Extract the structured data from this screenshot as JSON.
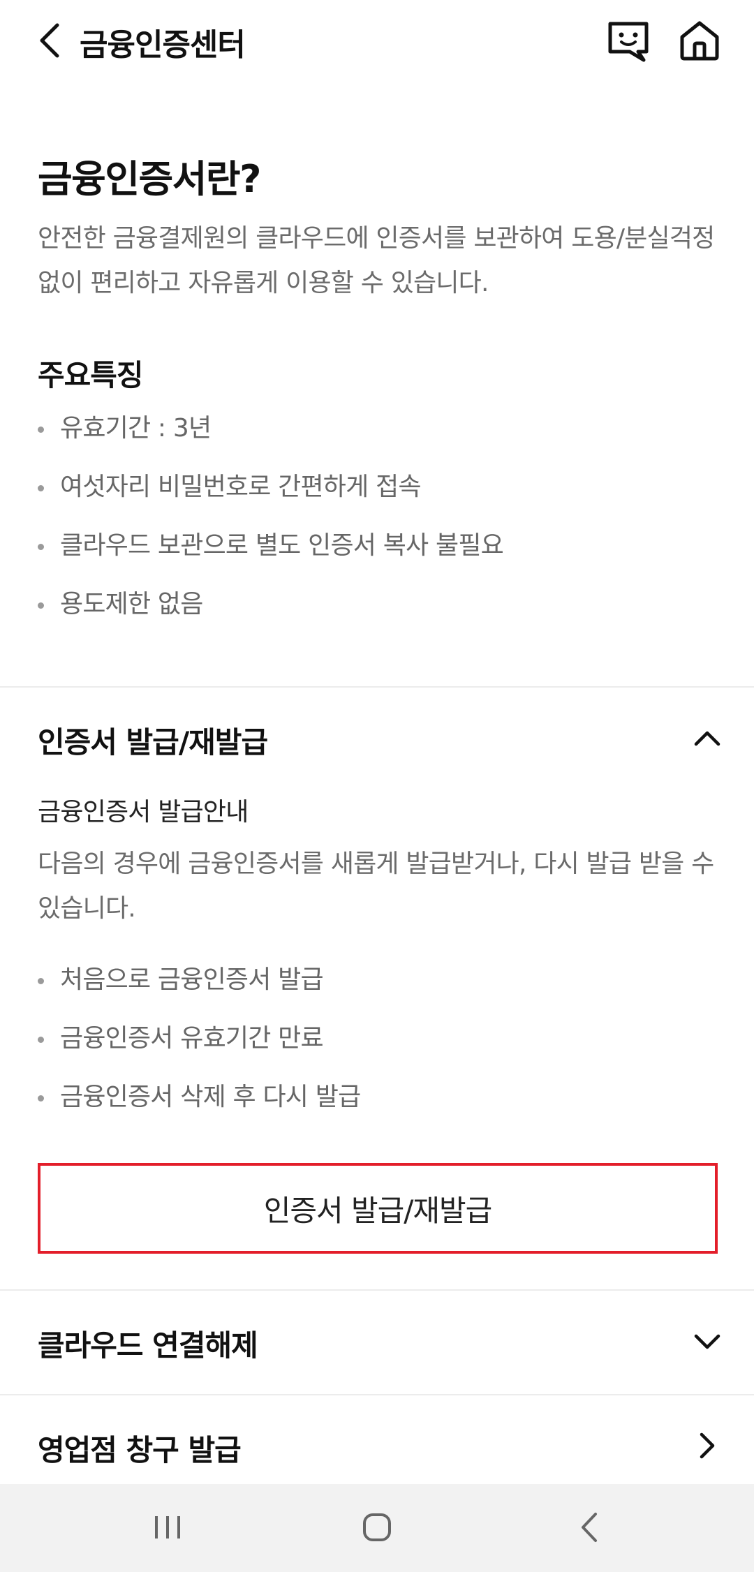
{
  "header": {
    "title": "금융인증센터",
    "icons": {
      "back": "chevron-left-icon",
      "chat": "chat-bot-icon",
      "home": "home-icon"
    }
  },
  "intro": {
    "title": "금융인증서란?",
    "description": "안전한 금융결제원의 클라우드에 인증서를 보관하여 도용/분실걱정 없이 편리하고 자유롭게 이용할 수 있습니다.",
    "features_title": "주요특징",
    "features": [
      "유효기간 : 3년",
      "여섯자리 비밀번호로 간편하게 접속",
      "클라우드 보관으로 별도 인증서 복사 불필요",
      "용도제한 없음"
    ]
  },
  "sections": {
    "issue": {
      "title": "인증서 발급/재발급",
      "expanded": true,
      "subtitle": "금융인증서 발급안내",
      "description": "다음의 경우에 금융인증서를 새롭게 발급받거나, 다시 발급 받을 수 있습니다.",
      "cases": [
        "처음으로 금융인증서 발급",
        "금융인증서 유효기간 만료",
        "금융인증서 삭제 후 다시 발급"
      ],
      "button_label": "인증서 발급/재발급",
      "highlight_color": "#e31e2a"
    },
    "cloud": {
      "title": "클라우드 연결해제",
      "expanded": false
    },
    "branch": {
      "title": "영업점 창구 발급"
    }
  },
  "nav": {
    "recents": "recents-icon",
    "home": "home-circle-icon",
    "back": "back-icon"
  }
}
